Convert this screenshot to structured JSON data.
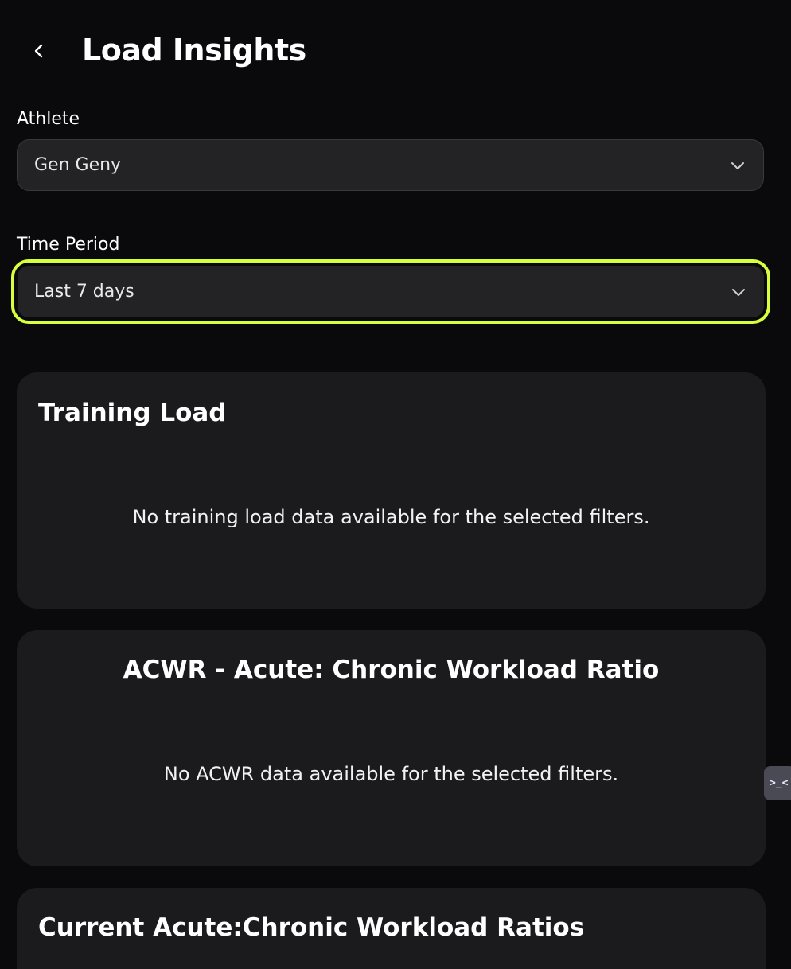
{
  "header": {
    "title": "Load Insights"
  },
  "filters": {
    "athlete": {
      "label": "Athlete",
      "value": "Gen Geny"
    },
    "time_period": {
      "label": "Time Period",
      "value": "Last 7 days"
    }
  },
  "cards": {
    "training_load": {
      "title": "Training Load",
      "empty_message": "No training load data available for the selected filters."
    },
    "acwr": {
      "title": "ACWR - Acute: Chronic Workload Ratio",
      "empty_message": "No ACWR data available for the selected filters."
    },
    "current_ratios": {
      "title": "Current Acute:Chronic Workload Ratios"
    }
  },
  "side_tab": {
    "glyph": ">_<"
  },
  "colors": {
    "background": "#0a0a0c",
    "card": "#1b1b1e",
    "input": "#232326",
    "focus_ring": "#d8ff3e"
  }
}
